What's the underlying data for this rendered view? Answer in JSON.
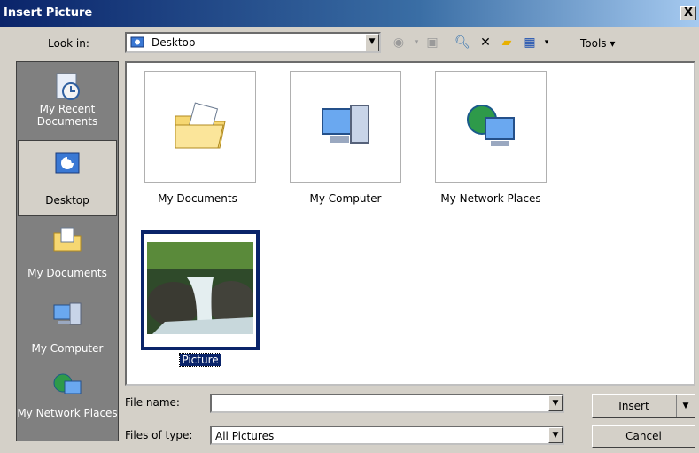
{
  "window": {
    "title": "Insert Picture",
    "close_glyph": "X"
  },
  "toolbar": {
    "look_in_label": "Look in:",
    "look_in_value": "Desktop",
    "tools_label": "Tools"
  },
  "places": [
    {
      "label": "My Recent Documents",
      "icon": "recent-documents-icon",
      "selected": false
    },
    {
      "label": "Desktop",
      "icon": "desktop-icon",
      "selected": true
    },
    {
      "label": "My Documents",
      "icon": "my-documents-icon",
      "selected": false
    },
    {
      "label": "My Computer",
      "icon": "my-computer-icon",
      "selected": false
    },
    {
      "label": "My Network Places",
      "icon": "network-places-icon",
      "selected": false
    }
  ],
  "files": [
    {
      "label": "My Documents",
      "icon": "my-documents-folder-icon"
    },
    {
      "label": "My Computer",
      "icon": "my-computer-icon"
    },
    {
      "label": "My Network Places",
      "icon": "network-places-icon"
    },
    {
      "label": "Picture",
      "icon": "waterfall-photo-thumbnail",
      "selected": true
    }
  ],
  "file_name": {
    "label": "File name:",
    "value": ""
  },
  "file_type": {
    "label": "Files of type:",
    "value": "All Pictures"
  },
  "buttons": {
    "insert": "Insert",
    "cancel": "Cancel"
  },
  "colors": {
    "title_bar": "#0a246a",
    "selection": "#0a246a",
    "face": "#d4d0c8"
  }
}
